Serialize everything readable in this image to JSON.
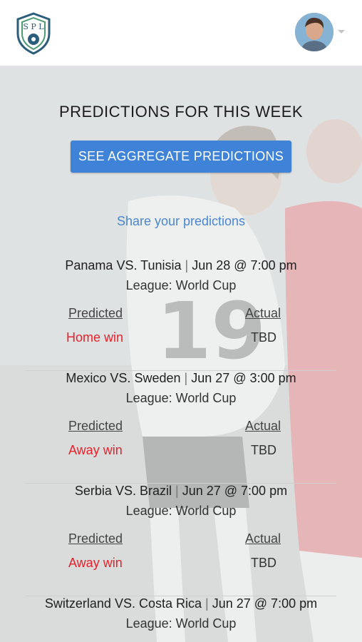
{
  "header": {
    "logo_alt": "SPL",
    "accent": "#3f83d9"
  },
  "page": {
    "title": "PREDICTIONS FOR THIS WEEK",
    "aggregate_button": "SEE AGGREGATE PREDICTIONS",
    "share_link": "Share your predictions"
  },
  "labels": {
    "predicted": "Predicted",
    "actual": "Actual"
  },
  "matches": [
    {
      "home": "Panama",
      "away": "Tunisia",
      "date": "Jun 28 @ 7:00 pm",
      "league": "League: World Cup",
      "prediction": "Home win",
      "actual": "TBD"
    },
    {
      "home": "Mexico ",
      "away": "Sweden",
      "date": "Jun 27 @ 3:00 pm",
      "league": "League: World Cup",
      "prediction": "Away win",
      "actual": "TBD"
    },
    {
      "home": "Serbia",
      "away": "Brazil",
      "date": "Jun 27 @ 7:00 pm",
      "league": "League: World Cup",
      "prediction": "Away win",
      "actual": "TBD"
    },
    {
      "home": "Switzerland",
      "away": "Costa Rica",
      "date": "Jun 27 @ 7:00 pm",
      "league": "League: World Cup",
      "prediction": "",
      "actual": ""
    }
  ],
  "vs_text": "VS.",
  "colors": {
    "prediction": "#e8212c",
    "link": "#4a86d4"
  }
}
